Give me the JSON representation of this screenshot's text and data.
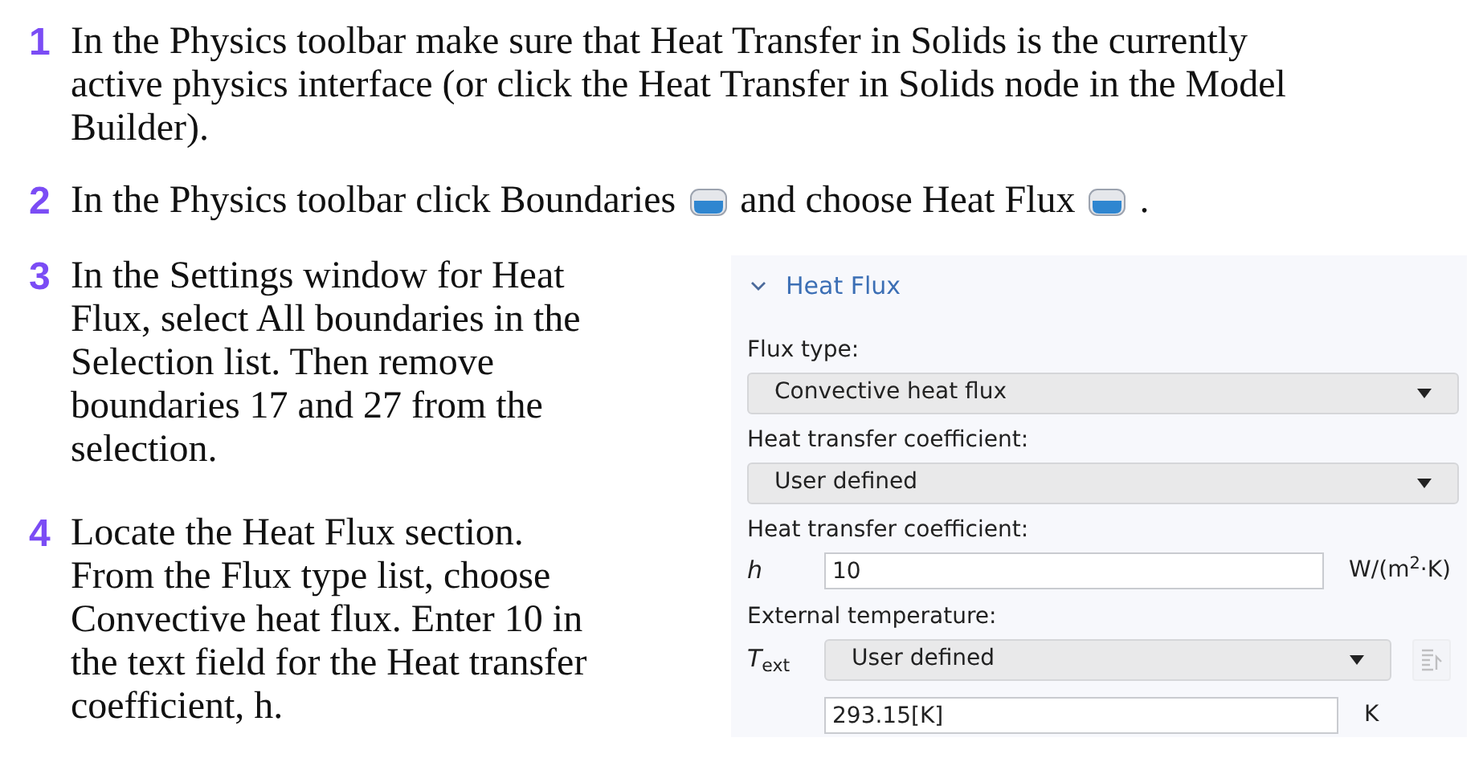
{
  "steps": [
    {
      "number": "1",
      "lines": [
        "In the Physics toolbar make sure that Heat Transfer in Solids is the currently",
        "active physics interface (or click the Heat Transfer in Solids node in the Model",
        "Builder)."
      ]
    },
    {
      "number": "2",
      "segments": [
        {
          "kind": "text",
          "text": "In the Physics toolbar click Boundaries"
        },
        {
          "kind": "icon"
        },
        {
          "kind": "text",
          "text": "and choose Heat Flux"
        },
        {
          "kind": "icon"
        },
        {
          "kind": "text",
          "text": "."
        }
      ]
    },
    {
      "number": "3",
      "lines": [
        "In the Settings window for Heat",
        "Flux, select All boundaries in the",
        "Selection list. Then remove",
        "boundaries 17 and 27 from the",
        "selection."
      ]
    },
    {
      "number": "4",
      "lines": [
        "Locate the Heat Flux section.",
        "From the Flux type list, choose",
        "Convective heat flux. Enter 10 in",
        "the text field for the Heat transfer",
        "coefficient, h."
      ]
    }
  ],
  "settings": {
    "section": {
      "title": "Heat Flux",
      "expanded": true
    },
    "rows": [
      {
        "kind": "label",
        "text": "Flux type:"
      },
      {
        "kind": "dropdown",
        "value": "Convective heat flux"
      },
      {
        "kind": "label",
        "text": "Heat transfer coefficient:"
      },
      {
        "kind": "dropdown",
        "value": "User defined"
      },
      {
        "kind": "label",
        "text": "Heat transfer coefficient:"
      },
      {
        "kind": "input",
        "symbol": "h",
        "value": "10",
        "unit": "W/(m$^{2}$·K)"
      },
      {
        "kind": "label",
        "text": "External temperature:"
      },
      {
        "kind": "symbol-dropdown",
        "symbol": "T",
        "subscript": "ext",
        "value": "User defined",
        "button_disabled": true
      },
      {
        "kind": "input",
        "value": "293.15[K]",
        "unit": "K"
      }
    ]
  }
}
